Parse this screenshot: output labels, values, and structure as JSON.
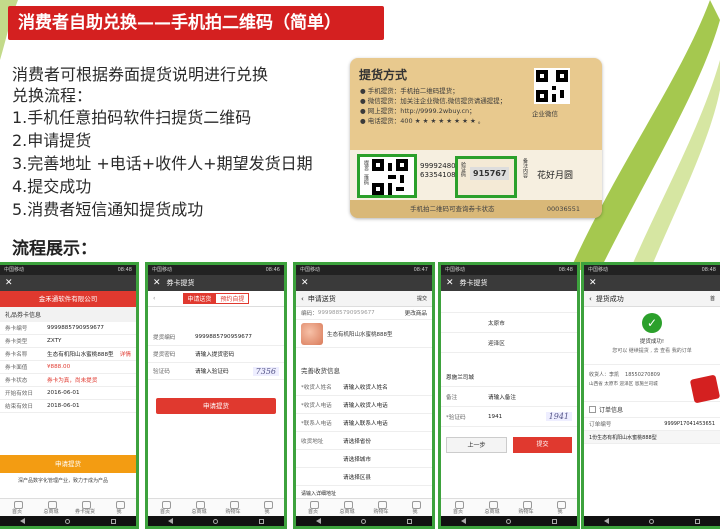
{
  "title": "消费者自助兑换——手机拍二维码（简单）",
  "intro": "消费者可根据券面提货说明进行兑换",
  "process_label": "兑换流程：",
  "steps": [
    "1.手机任意拍码软件扫提货二维码",
    "2.申请提货",
    "3.完善地址 +电话+收件人+期望发货日期",
    "4.提交成功",
    "5.消费者短信通知提货成功"
  ],
  "flow_heading": "流程展示：",
  "card": {
    "title": "提货方式",
    "lines": [
      "● 手机提货：手机拍二维码提货；",
      "● 微信提货：加关注企业微信,微信提货请通提提；",
      "● 网上提货：http://9999.2wbuy.cn；",
      "● 电话提货：400 ★ ★ ★ ★ ★ ★ ★ ★ 。"
    ],
    "qr_label": "提货二维码",
    "serial": "99992480 63354108",
    "verify_label": "验证码",
    "verify_code": "915767",
    "note_label": "备注内容",
    "product": "花好月圆",
    "footer": "手机拍二维码可查询券卡状态",
    "number": "00036551",
    "corner_label": "企业微信"
  },
  "phones": {
    "p1": {
      "status_left": "中国移动",
      "status_right": "08:48",
      "company": "金禾通软件有限公司",
      "section": "礼品券卡信息",
      "rows": [
        {
          "k": "券卡编号",
          "v": "9999885790959677"
        },
        {
          "k": "券卡类型",
          "v": "ZXTY"
        },
        {
          "k": "券卡名称",
          "v": "生态有机阳山水蜜桃888型"
        },
        {
          "k": "券卡面值",
          "v": "¥888.00"
        },
        {
          "k": "券卡状态",
          "v": "券卡为真，尚未提货"
        },
        {
          "k": "开始有效日",
          "v": "2016-06-01"
        },
        {
          "k": "结束有效日",
          "v": "2018-06-01"
        }
      ],
      "detail": "详情",
      "button": "申请提货",
      "banner": "深产品数字化管理产业，致力于成为产品",
      "tabs": [
        "首页",
        "总商城",
        "券卡提货",
        "我"
      ]
    },
    "p2": {
      "status_left": "中国移动",
      "status_right": "08:46",
      "title": "券卡提货",
      "tab_a": "申请送货",
      "tab_b": "预约自提",
      "rows": [
        {
          "k": "提货编码",
          "v": "9999885790959677"
        },
        {
          "k": "提货密码",
          "v": "请输入提货密码"
        },
        {
          "k": "验证码",
          "v": "请输入验证码"
        }
      ],
      "captcha": "7356",
      "button": "申请提货",
      "tabs": [
        "首页",
        "总商城",
        "购物车",
        "我"
      ]
    },
    "p3": {
      "status_left": "中国移动",
      "status_right": "08:47",
      "title": "申请送货",
      "submit": "提交",
      "code_label": "编码：",
      "code_value": "9999885790959677",
      "change": "更改商品",
      "product": "生态有机阳山水蜜桃888型",
      "section": "完善收货信息",
      "rows": [
        {
          "k": "*收货人姓名",
          "v": "请输入收货人姓名"
        },
        {
          "k": "*收货人电话",
          "v": "请输入收货人电话"
        },
        {
          "k": "*联系人电话",
          "v": "请输入联系人电话"
        },
        {
          "k": "收货地址",
          "v": "请选择省份"
        },
        {
          "k": "",
          "v": "请选择城市"
        },
        {
          "k": "",
          "v": "请选择区县"
        }
      ],
      "detail_placeholder": "请输入详细地址",
      "tabs": [
        "首页",
        "总商城",
        "购物车",
        "我"
      ]
    },
    "p4": {
      "status_left": "中国移动",
      "status_right": "08:48",
      "title": "券卡提货",
      "rows": [
        {
          "k": "",
          "v": "太原市"
        },
        {
          "k": "",
          "v": "迎泽区"
        },
        {
          "k": "",
          "v": "恩施兰司城"
        },
        {
          "k": "备注",
          "v": "请输入备注"
        },
        {
          "k": "*验证码",
          "v": "1941"
        }
      ],
      "captcha": "1941",
      "prev": "上一步",
      "submit": "提交",
      "tabs": [
        "首页",
        "总商城",
        "购物车",
        "我"
      ]
    },
    "p5": {
      "status_left": "中国移动",
      "status_right": "08:48",
      "title": "提货成功",
      "home": "首",
      "msg1": "提货成功!",
      "msg2": "您可以 继续提货 , 去 查看 我的订单",
      "recv_label": "收货人：李凯",
      "phone": "18550270809",
      "addr": "山西省 太原市 迎泽区 恩施兰司城",
      "order_section": "订单信息",
      "order_no_label": "订单编号",
      "order_no": "9999P17041453651",
      "order_item": "1份生态有机阳山水蜜桃888型"
    }
  }
}
